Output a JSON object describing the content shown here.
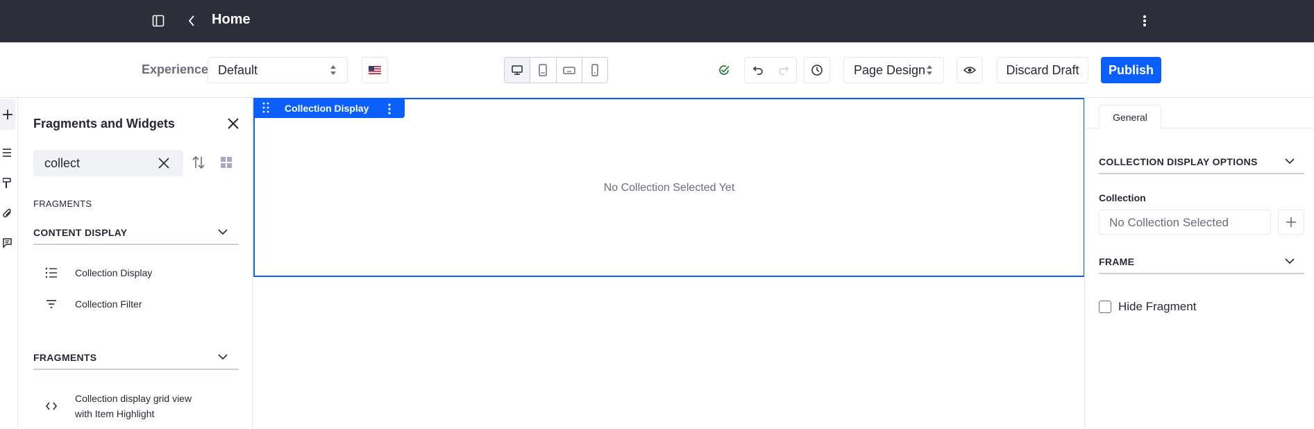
{
  "header": {
    "title": "Home",
    "icons": [
      "sidebar-toggle-icon",
      "back-chevron-icon",
      "kebab-menu-icon"
    ]
  },
  "toolbar": {
    "experience_label": "Experience",
    "experience_value": "Default",
    "language_icon": "us-flag-icon",
    "devices": [
      "desktop-icon",
      "tablet-icon",
      "landscape-phone-icon",
      "portrait-phone-icon"
    ],
    "status_icon": "saved-check-icon",
    "undo_icon": "undo-icon",
    "redo_icon": "redo-icon",
    "history_icon": "history-icon",
    "mode_value": "Page Design",
    "preview_icon": "eye-icon",
    "discard_label": "Discard Draft",
    "publish_label": "Publish",
    "accent_color": "#0b5fff"
  },
  "sidebar": {
    "title": "Fragments and Widgets",
    "search_value": "collect",
    "section_label": "FRAGMENTS",
    "groups": [
      {
        "label": "CONTENT DISPLAY",
        "items": [
          {
            "label": "Collection Display",
            "icon": "list-icon"
          },
          {
            "label": "Collection Filter",
            "icon": "filter-icon"
          }
        ]
      },
      {
        "label": "FRAGMENTS",
        "items": [
          {
            "label_line1": "Collection display grid view",
            "label_line2": "with Item Highlight",
            "icon": "code-icon"
          }
        ]
      }
    ]
  },
  "canvas": {
    "fragment_label": "Collection Display",
    "empty_message": "No Collection Selected Yet"
  },
  "config": {
    "tab_label": "General",
    "section_options": "COLLECTION DISPLAY OPTIONS",
    "collection_label": "Collection",
    "collection_value": "No Collection Selected",
    "section_frame": "FRAME",
    "hide_label": "Hide Fragment"
  }
}
